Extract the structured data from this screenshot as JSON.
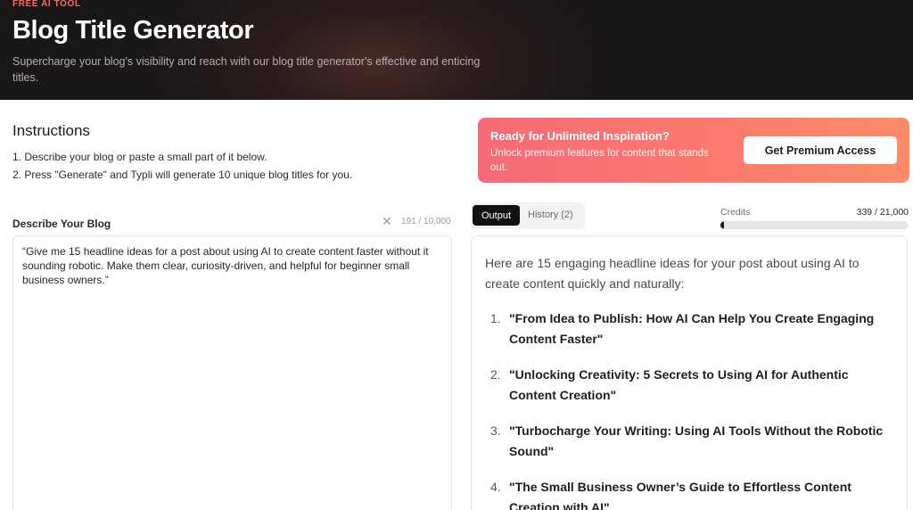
{
  "hero": {
    "eyebrow": "FREE AI TOOL",
    "title": "Blog Title Generator",
    "subtitle": "Supercharge your blog's visibility and reach with our blog title generator's effective and enticing titles."
  },
  "instructions": {
    "heading": "Instructions",
    "steps": [
      "1. Describe your blog or paste a small part of it below.",
      "2. Press \"Generate\" and Typli will generate 10 unique blog titles for you."
    ]
  },
  "promo": {
    "title": "Ready for Unlimited Inspiration?",
    "text": "Unlock premium features for content that stands out.",
    "button_label": "Get Premium Access"
  },
  "input": {
    "label": "Describe Your Blog",
    "clear_icon": "close-icon",
    "char_count": "191 / 10,000",
    "value": "“Give me 15 headline ideas for a post about using AI to create content faster without it sounding robotic. Make them clear, curiosity-driven, and helpful for beginner small business owners.”"
  },
  "tabs": {
    "output_label": "Output",
    "history_label": "History (2)"
  },
  "credits": {
    "label": "Credits",
    "value": "339 / 21,000",
    "used_fraction": 0.016
  },
  "output": {
    "intro": "Here are 15 engaging headline ideas for your post about using AI to create content quickly and naturally:",
    "items": [
      {
        "num": "1.",
        "text": "\"From Idea to Publish: How AI Can Help You Create Engaging Content Faster\""
      },
      {
        "num": "2.",
        "text": "\"Unlocking Creativity: 5 Secrets to Using AI for Authentic Content Creation\""
      },
      {
        "num": "3.",
        "text": "\"Turbocharge Your Writing: Using AI Tools Without the Robotic Sound\""
      },
      {
        "num": "4.",
        "text": "\"The Small Business Owner’s Guide to Effortless Content Creation with AI\""
      }
    ]
  },
  "colors": {
    "accent": "#ff6a5c",
    "promo_start": "#f56a78",
    "promo_end": "#fd8c6a",
    "tab_active": "#111111"
  }
}
